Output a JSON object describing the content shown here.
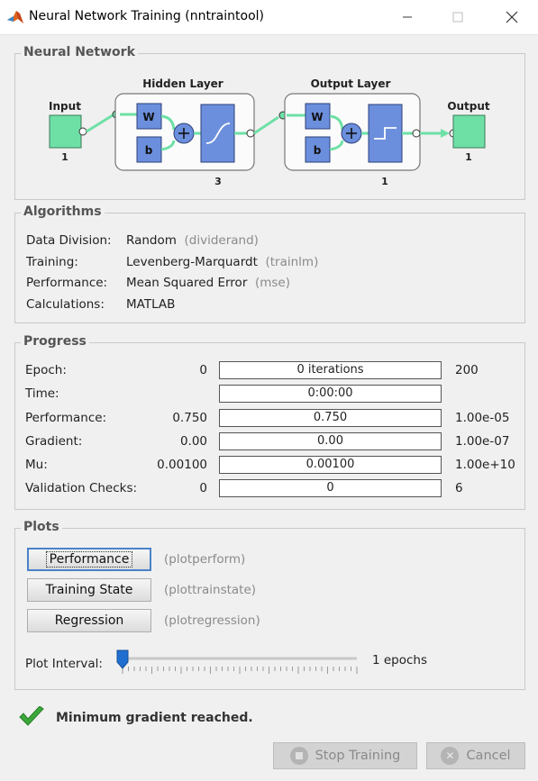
{
  "window": {
    "title": "Neural Network Training (nntraintool)"
  },
  "network": {
    "panel_title": "Neural Network",
    "input_label": "Input",
    "input_size": "1",
    "hidden_title": "Hidden Layer",
    "hidden_size": "3",
    "output_layer_title": "Output Layer",
    "output_layer_size": "1",
    "output_label": "Output",
    "output_size": "1",
    "w_label": "W",
    "b_label": "b"
  },
  "algorithms": {
    "panel_title": "Algorithms",
    "rows": [
      {
        "label": "Data Division:",
        "value": "Random",
        "fn": "(dividerand)"
      },
      {
        "label": "Training:",
        "value": "Levenberg-Marquardt",
        "fn": "(trainlm)"
      },
      {
        "label": "Performance:",
        "value": "Mean Squared Error",
        "fn": "(mse)"
      },
      {
        "label": "Calculations:",
        "value": "MATLAB",
        "fn": ""
      }
    ]
  },
  "progress": {
    "panel_title": "Progress",
    "rows": [
      {
        "label": "Epoch:",
        "start": "0",
        "current": "0 iterations",
        "end": "200"
      },
      {
        "label": "Time:",
        "start": "",
        "current": "0:00:00",
        "end": ""
      },
      {
        "label": "Performance:",
        "start": "0.750",
        "current": "0.750",
        "end": "1.00e-05"
      },
      {
        "label": "Gradient:",
        "start": "0.00",
        "current": "0.00",
        "end": "1.00e-07"
      },
      {
        "label": "Mu:",
        "start": "0.00100",
        "current": "0.00100",
        "end": "1.00e+10"
      },
      {
        "label": "Validation Checks:",
        "start": "0",
        "current": "0",
        "end": "6"
      }
    ]
  },
  "plots": {
    "panel_title": "Plots",
    "buttons": [
      {
        "label": "Performance",
        "fn": "(plotperform)"
      },
      {
        "label": "Training State",
        "fn": "(plottrainstate)"
      },
      {
        "label": "Regression",
        "fn": "(plotregression)"
      }
    ],
    "interval_label": "Plot Interval:",
    "interval_value": "1 epochs",
    "interval_fraction": 0.0
  },
  "status": {
    "message": "Minimum gradient reached."
  },
  "footer": {
    "stop_label": "Stop Training",
    "cancel_label": "Cancel"
  },
  "colors": {
    "accent": "#1f6fd1",
    "node_green": "#6ee0a6",
    "block_blue": "#6b8fdc",
    "check_green": "#3aa83a"
  }
}
